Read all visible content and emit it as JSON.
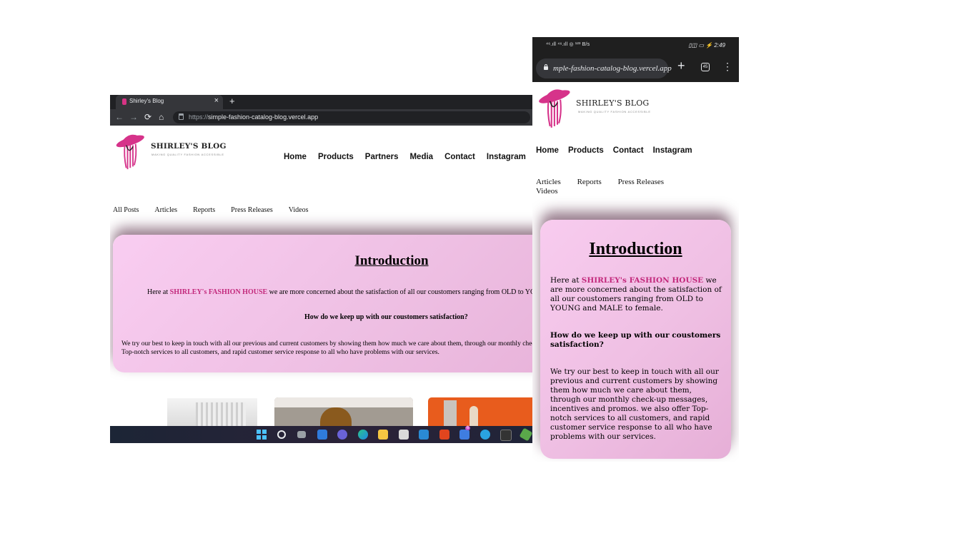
{
  "desktop": {
    "tab": {
      "title": "Shirley's Blog",
      "close": "×",
      "new_tab": "+"
    },
    "url": {
      "scheme": "https://",
      "host": "simple-fashion-catalog-blog.vercel.app"
    },
    "brand": {
      "name": "SHIRLEY'S BLOG",
      "tagline": "MAKING QUALITY FASHION ACCESSIBLE"
    },
    "nav": [
      "Home",
      "Products",
      "Partners",
      "Media",
      "Contact",
      "Instagram"
    ],
    "categories": [
      "All Posts",
      "Articles",
      "Reports",
      "Press Releases",
      "Videos"
    ],
    "intro": {
      "title": "Introduction",
      "p1_before": "Here at ",
      "p1_highlight": "SHIRLEY's FASHION HOUSE",
      "p1_after": " we are more concerned about the satisfaction of all our coustomers ranging from OLD to YOUNG and MALE to female.",
      "question": "How do we keep up with our coustomers satisfaction?",
      "p2": "We try our best to keep in touch with all our previous and current customers by showing them how much we care about them, through our monthly check-up messages, incentives and promos. we also offer Top-notch services to all customers, and rapid customer service response to all who have problems with our services."
    },
    "taskbar_icons": [
      "windows-start",
      "search",
      "task-view",
      "widgets",
      "teams-chat",
      "edge",
      "file-explorer",
      "store",
      "mail",
      "office",
      "todo",
      "telegram",
      "terminal",
      "node"
    ],
    "todo_badge": "6"
  },
  "phone": {
    "status": {
      "left": "⁴⁶.ıll ⁴⁶.ıll ◎ ¹²³ B/s",
      "right": "▯◫ ▭ ⚡ 2:49"
    },
    "url": "mple-fashion-catalog-blog.vercel.app",
    "tab_count": "45",
    "brand": {
      "name": "SHIRLEY'S BLOG",
      "tagline": "MAKING QUALITY FASHION ACCESSIBLE"
    },
    "nav": [
      "Home",
      "Products",
      "Contact",
      "Instagram"
    ],
    "categories": [
      "Articles",
      "Reports",
      "Press Releases",
      "Videos"
    ],
    "intro": {
      "title": "Introduction",
      "p1_before": "Here at ",
      "p1_highlight": "SHIRLEY's FASHION HOUSE",
      "p1_after": " we are more concerned about the satisfaction of all our coustomers ranging from OLD to YOUNG and MALE to female.",
      "question": "How do we keep up with our coustomers satisfaction?",
      "p2": "We try our best to keep in touch with all our previous and current customers by showing them how much we care about them, through our monthly check-up messages, incentives and promos. we also offer Top-notch services to all customers, and rapid customer service response to all who have problems with our services."
    }
  },
  "colors": {
    "brand_pink": "#c2287b",
    "card_pink": "#f5c8ec",
    "logo_magenta": "#d6338a"
  }
}
